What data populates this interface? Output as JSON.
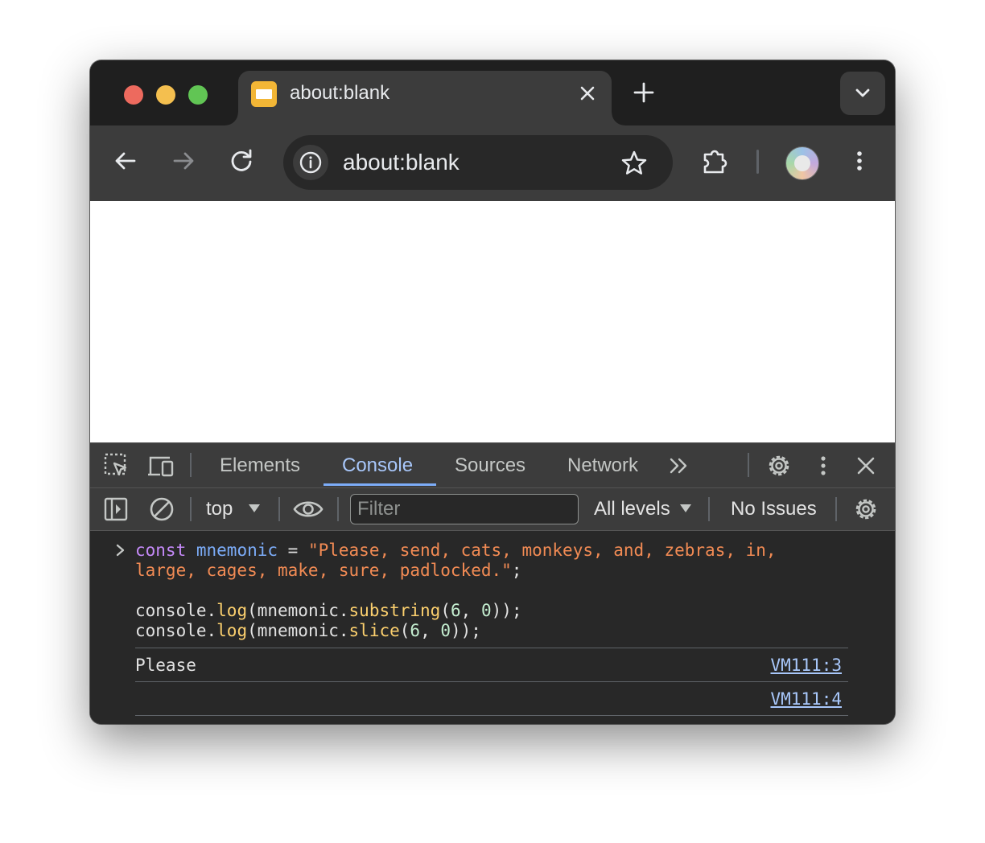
{
  "browser": {
    "tab": {
      "title": "about:blank"
    },
    "address_bar": {
      "url": "about:blank"
    }
  },
  "devtools": {
    "tabs": [
      "Elements",
      "Console",
      "Sources",
      "Network"
    ],
    "active_tab": "Console",
    "console_toolbar": {
      "context": "top",
      "filter_placeholder": "Filter",
      "levels": "All levels",
      "issues": "No Issues"
    },
    "input": {
      "line1": {
        "kw": "const",
        "var": "mnemonic",
        "op": " = ",
        "str": "\"Please, send, cats, monkeys, and, zebras, in,"
      },
      "line2": {
        "str": "large, cages, make, sure, padlocked.\"",
        "end": ";"
      },
      "line3": {
        "obj": "console.",
        "fn": "log",
        "open": "(mnemonic.",
        "method": "substring",
        "p1": "(",
        "n1": "6",
        "comma": ", ",
        "n2": "0",
        "close": "));"
      },
      "line4": {
        "obj": "console.",
        "fn": "log",
        "open": "(mnemonic.",
        "method": "slice",
        "p1": "(",
        "n1": "6",
        "comma": ", ",
        "n2": "0",
        "close": "));"
      }
    },
    "logs": [
      {
        "text": "Please",
        "source": "VM111:3"
      },
      {
        "text": "",
        "source": "VM111:4"
      }
    ]
  }
}
